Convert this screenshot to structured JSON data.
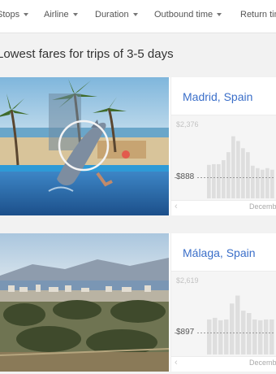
{
  "filters": [
    {
      "label": "Stops"
    },
    {
      "label": "Airline"
    },
    {
      "label": "Duration"
    },
    {
      "label": "Outbound time"
    },
    {
      "label": "Return time"
    }
  ],
  "heading": "Lowest fares for trips of 3-5 days",
  "cards": [
    {
      "city": "Madrid, Spain",
      "max_price": "$2,376",
      "min_price": "$888",
      "month": "December",
      "bar_values": [
        0.42,
        0.43,
        0.43,
        0.48,
        0.58,
        0.78,
        0.72,
        0.63,
        0.58,
        0.41,
        0.38,
        0.36,
        0.38,
        0.36
      ],
      "min_level": 0.26
    },
    {
      "city": "Málaga, Spain",
      "max_price": "$2,619",
      "min_price": "$897",
      "month": "December",
      "bar_values": [
        0.44,
        0.46,
        0.43,
        0.44,
        0.64,
        0.74,
        0.55,
        0.52,
        0.44,
        0.43,
        0.44,
        0.44
      ],
      "min_level": 0.27
    }
  ],
  "colors": {
    "accent": "#3b6fc9",
    "bar": "#dedede",
    "min_line": "#9a9a9a"
  }
}
